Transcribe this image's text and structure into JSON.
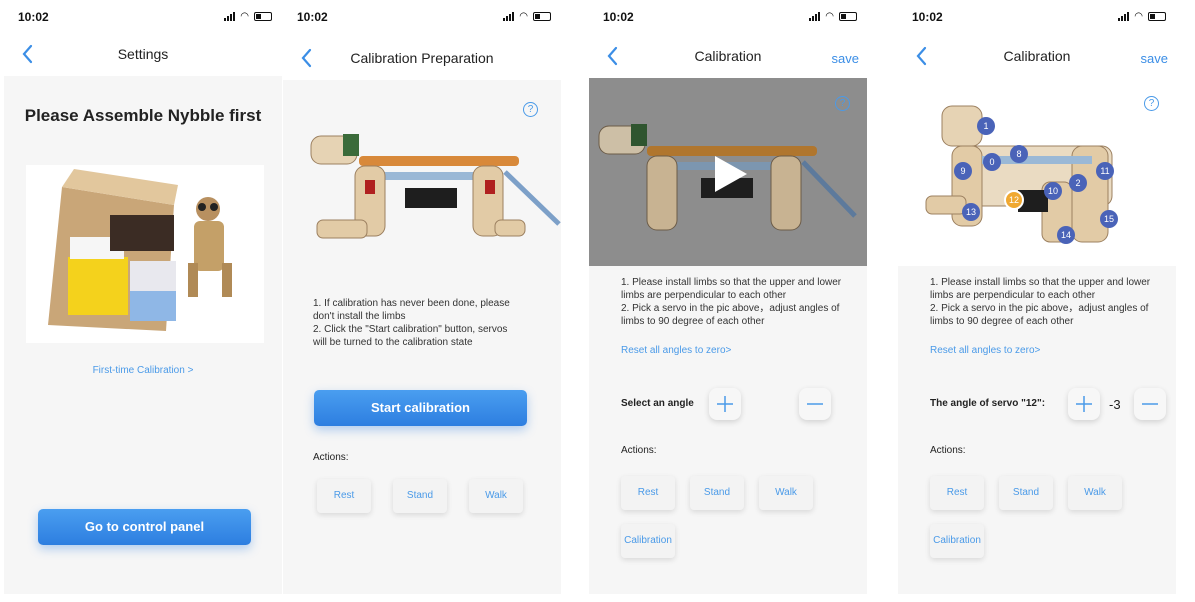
{
  "status": {
    "time": "10:02"
  },
  "screen1": {
    "nav_title": "Settings",
    "heading": "Please Assemble Nybble first",
    "link_calibration": "First-time Calibration >",
    "control_button": "Go to control panel"
  },
  "screen2": {
    "nav_title": "Calibration Preparation",
    "instruction": "1. If calibration has never been done, please don't install the limbs\n2. Click the \"Start calibration\" button, servos will be turned to the calibration state",
    "start_button": "Start calibration",
    "actions_label": "Actions:",
    "actions": [
      "Rest",
      "Stand",
      "Walk"
    ]
  },
  "screen3": {
    "nav_title": "Calibration",
    "save": "save",
    "instruction": "1. Please install limbs so that the upper and lower limbs are perpendicular to each other\n2. Pick a servo in the pic above，adjust angles of limbs to 90 degree of each other",
    "reset_link": "Reset all angles to zero>",
    "select_label": "Select an angle",
    "actions_label": "Actions:",
    "actions": [
      "Rest",
      "Stand",
      "Walk",
      "Calibration"
    ]
  },
  "screen4": {
    "nav_title": "Calibration",
    "save": "save",
    "instruction": "1. Please install limbs so that the upper and lower limbs are perpendicular to each other\n2. Pick a servo in the pic above，adjust angles of limbs to 90 degree of each other",
    "reset_link": "Reset all angles to zero>",
    "servo_label": "The angle of servo \"12\":",
    "servo_value": "-3",
    "actions_label": "Actions:",
    "actions": [
      "Rest",
      "Stand",
      "Walk",
      "Calibration"
    ],
    "servos": [
      "1",
      "0",
      "8",
      "9",
      "10",
      "2",
      "11",
      "13",
      "12",
      "15",
      "14"
    ],
    "selected_servo": "12"
  },
  "colors": {
    "accent": "#3b8ee6",
    "badge": "#4a63b8",
    "selected": "#f0a830"
  }
}
